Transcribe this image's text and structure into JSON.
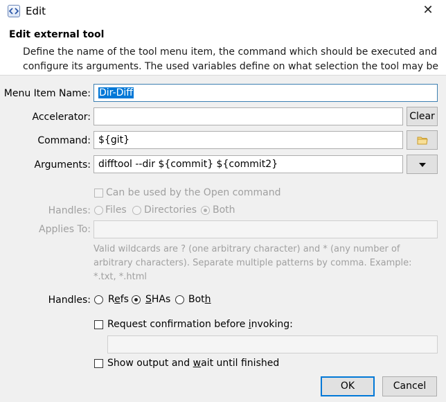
{
  "window": {
    "title": "Edit",
    "close_glyph": "✕"
  },
  "header": {
    "title": "Edit external tool",
    "description": "Define the name of the tool menu item, the command which should be executed and configure its arguments. The used variables define on what selection the tool may be used."
  },
  "form": {
    "menu_item_name": {
      "label": "Menu Item Name:",
      "value": "Dir-Diff"
    },
    "accelerator": {
      "label": "Accelerator:",
      "value": "",
      "clear_label": "Clear"
    },
    "command": {
      "label": "Command:",
      "value": "${git}",
      "browse_icon": "folder-icon"
    },
    "arguments": {
      "label": "Arguments:",
      "value": "difftool --dir ${commit} ${commit2}",
      "dropdown_icon": "triangle-down-icon"
    },
    "open_command": {
      "label": "Can be used by the Open command",
      "checked": false,
      "enabled": false
    },
    "file_handles": {
      "label": "Handles:",
      "enabled": false,
      "options": [
        {
          "label": "Files",
          "checked": false
        },
        {
          "label": "Directories",
          "checked": false
        },
        {
          "label": "Both",
          "checked": true
        }
      ]
    },
    "applies_to": {
      "label": "Applies To:",
      "value": "",
      "hint": "Valid wildcards are ? (one arbitrary character) and * (any number of arbitrary characters). Separate multiple patterns by comma. Example: *.txt, *.html"
    },
    "commit_handles": {
      "label": "Handles:",
      "options": [
        {
          "pre": "R",
          "mn": "e",
          "post": "fs",
          "checked": false
        },
        {
          "pre": "",
          "mn": "S",
          "post": "HAs",
          "checked": true
        },
        {
          "pre": "Bot",
          "mn": "h",
          "post": "",
          "checked": false
        }
      ]
    },
    "confirm": {
      "pre": "Request confirmation before ",
      "mn": "i",
      "post": "nvoking:",
      "checked": false,
      "text_value": ""
    },
    "show_output": {
      "pre": "Show output and ",
      "mn": "w",
      "post": "ait until finished",
      "checked": false
    }
  },
  "buttons": {
    "ok": "OK",
    "cancel": "Cancel"
  },
  "colors": {
    "selection": "#0078d7",
    "focus_border": "#3c7fb1",
    "panel_bg": "#f0f0f0",
    "disabled_text": "#a0a0a0"
  }
}
